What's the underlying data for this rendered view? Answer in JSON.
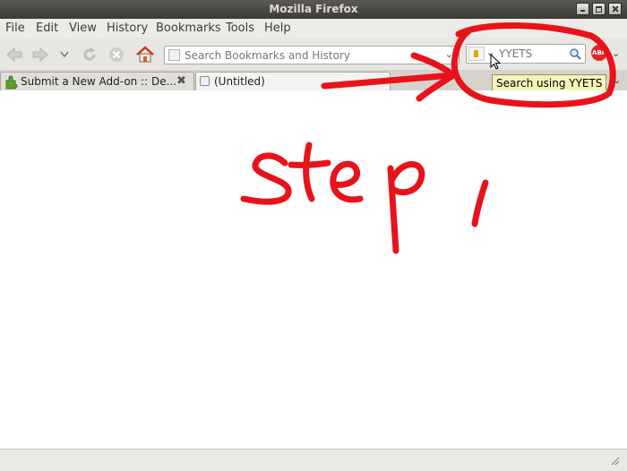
{
  "window": {
    "title": "Mozilla Firefox"
  },
  "menu": {
    "items": [
      {
        "label": "File"
      },
      {
        "label": "Edit"
      },
      {
        "label": "View"
      },
      {
        "label": "History"
      },
      {
        "label": "Bookmarks"
      },
      {
        "label": "Tools"
      },
      {
        "label": "Help"
      }
    ]
  },
  "navbar": {
    "url_placeholder": "Search Bookmarks and History",
    "search_placeholder": "YYETS"
  },
  "tabs": [
    {
      "label": "Submit a New Add-on :: De..."
    },
    {
      "label": "(Untitled)"
    }
  ],
  "tooltip": {
    "text": "Search using YYETS"
  },
  "annotation": {
    "text": "step1",
    "color": "#e8131a"
  },
  "colors": {
    "titlebar": "#3c3b37",
    "toolbar": "#e8e6e2",
    "tooltip_bg": "#f5f3b6"
  }
}
